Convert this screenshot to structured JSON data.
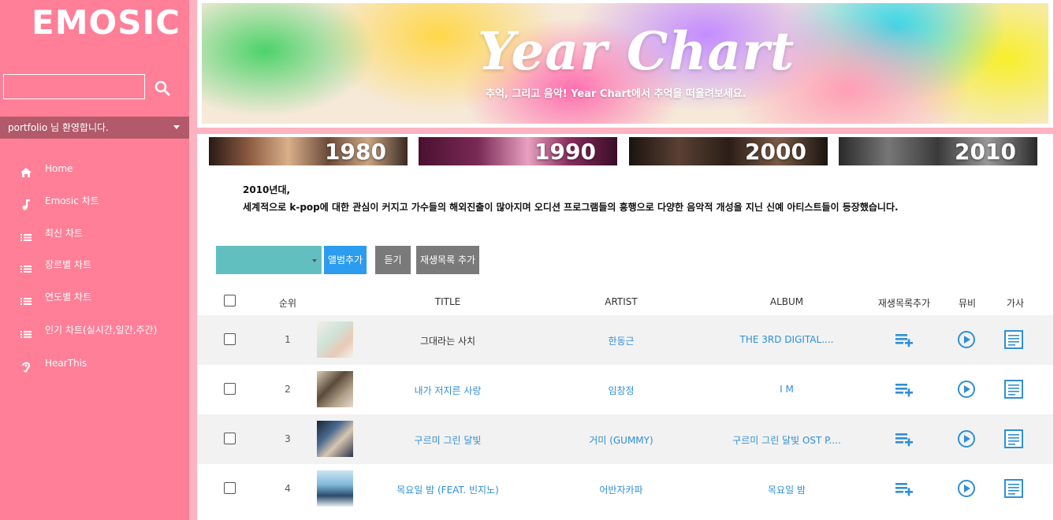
{
  "app": {
    "logo": "EMOSIC"
  },
  "sidebar": {
    "search_placeholder": "",
    "user_text": "portfolio 님 환영합니다.",
    "items": [
      {
        "label": "Home",
        "icon": "home-icon"
      },
      {
        "label": "Emosic 차트",
        "icon": "music-note-icon"
      },
      {
        "label": "최신 차트",
        "icon": "list-icon"
      },
      {
        "label": "장르별 차트",
        "icon": "list-icon"
      },
      {
        "label": "연도별 차트",
        "icon": "list-icon"
      },
      {
        "label": "인기 차트(실시간,일간,주간)",
        "icon": "list-icon"
      },
      {
        "label": "HearThis",
        "icon": "hearing-icon"
      }
    ]
  },
  "banner": {
    "title": "Year Chart",
    "subtitle": "추억, 그리고 음악! Year Chart에서 추억을 떠올려보세요."
  },
  "decades": [
    "1980",
    "1990",
    "2000",
    "2010"
  ],
  "description": {
    "title": "2010년대,",
    "text": "세계적으로 k-pop에 대한 관심이 커지고 가수들의 해외진출이 많아지며 오디션 프로그램들의 흥행으로 다양한 음악적 개성을 지닌 신예 아티스트들이 등장했습니다."
  },
  "controls": {
    "select_value": "",
    "add_album": "앨범추가",
    "listen": "듣기",
    "add_playlist": "재생목록 추가"
  },
  "table": {
    "headers": {
      "rank": "순위",
      "title": "TITLE",
      "artist": "ARTIST",
      "album": "ALBUM",
      "add_playlist": "재생목록추가",
      "mv": "뮤비",
      "lyrics": "가사"
    },
    "rows": [
      {
        "rank": "1",
        "title": "그대라는 사치",
        "artist": "한동근",
        "album": "THE 3RD DIGITAL...."
      },
      {
        "rank": "2",
        "title": "내가 저지른 사랑",
        "artist": "임창정",
        "album": "I M"
      },
      {
        "rank": "3",
        "title": "구르미 그린 달빛",
        "artist": "거미 (GUMMY)",
        "album": "구르미 그린 달빛 OST P...."
      },
      {
        "rank": "4",
        "title": "목요일 밤 (FEAT. 빈지노)",
        "artist": "어반자카파",
        "album": "목요일 밤"
      }
    ]
  },
  "colors": {
    "sidebar": "#ff7f98",
    "sidebar_user_bar": "#b25a6a",
    "page_bg": "#ffb3c0",
    "accent_blue": "#2c9cf0",
    "link_blue": "#2f8fd6",
    "select_teal": "#62bfbf",
    "button_gray": "#7a7a7a"
  }
}
